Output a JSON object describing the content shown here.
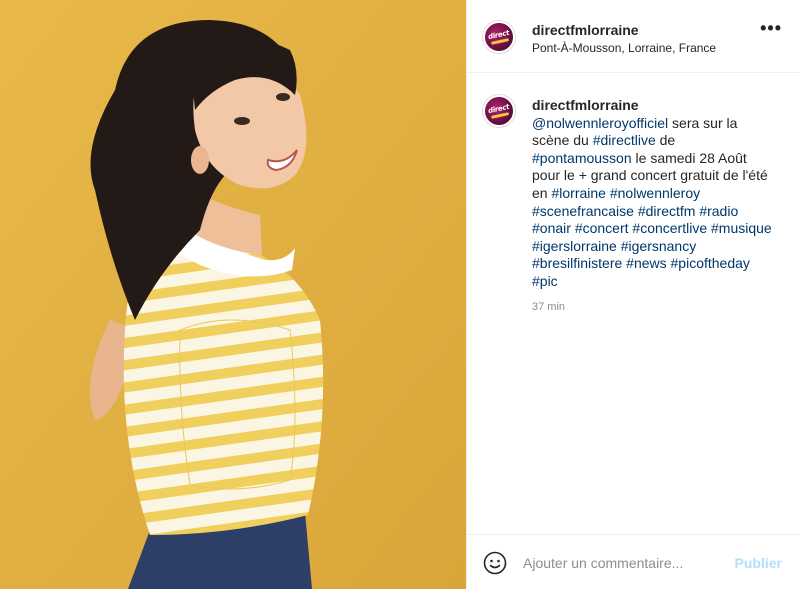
{
  "post": {
    "photo_alt": "woman in yellow striped polo shirt smiling",
    "colors": {
      "background": "#e1b243",
      "link": "#00376b",
      "muted": "#8e8e8e",
      "publish_disabled": "#b2dffc"
    }
  },
  "header": {
    "username": "directfmlorraine",
    "location": "Pont-À-Mousson, Lorraine, France",
    "more_icon": "more-horizontal-icon",
    "more_label": "•••"
  },
  "comment": {
    "username": "directfmlorraine",
    "caption_parts": [
      {
        "text": "@nolwennleroyofficiel",
        "link": true
      },
      {
        "text": " sera sur la scène du ",
        "link": false
      },
      {
        "text": "#directlive",
        "link": true
      },
      {
        "text": " de ",
        "link": false
      },
      {
        "text": "#pontamousson",
        "link": true
      },
      {
        "text": " le samedi 28 Août pour le + grand concert gratuit de l'été en ",
        "link": false
      },
      {
        "text": "#lorraine",
        "link": true
      },
      {
        "text": " ",
        "link": false
      },
      {
        "text": "#nolwennleroy",
        "link": true
      },
      {
        "text": " ",
        "link": false
      },
      {
        "text": "#scenefrancaise",
        "link": true
      },
      {
        "text": " ",
        "link": false
      },
      {
        "text": "#directfm",
        "link": true
      },
      {
        "text": " ",
        "link": false
      },
      {
        "text": "#radio",
        "link": true
      },
      {
        "text": " ",
        "link": false
      },
      {
        "text": "#onair",
        "link": true
      },
      {
        "text": " ",
        "link": false
      },
      {
        "text": "#concert",
        "link": true
      },
      {
        "text": " ",
        "link": false
      },
      {
        "text": "#concertlive",
        "link": true
      },
      {
        "text": " ",
        "link": false
      },
      {
        "text": "#musique",
        "link": true
      },
      {
        "text": " ",
        "link": false
      },
      {
        "text": "#igerslorraine",
        "link": true
      },
      {
        "text": " ",
        "link": false
      },
      {
        "text": "#igersnancy",
        "link": true
      },
      {
        "text": " ",
        "link": false
      },
      {
        "text": "#bresilfinistere",
        "link": true
      },
      {
        "text": " ",
        "link": false
      },
      {
        "text": "#news",
        "link": true
      },
      {
        "text": " ",
        "link": false
      },
      {
        "text": "#picoftheday",
        "link": true
      },
      {
        "text": " ",
        "link": false
      },
      {
        "text": "#pic",
        "link": true
      }
    ],
    "time": "37 min"
  },
  "footer": {
    "emoji_icon": "smiley-face-icon",
    "placeholder": "Ajouter un commentaire...",
    "publish_label": "Publier"
  }
}
